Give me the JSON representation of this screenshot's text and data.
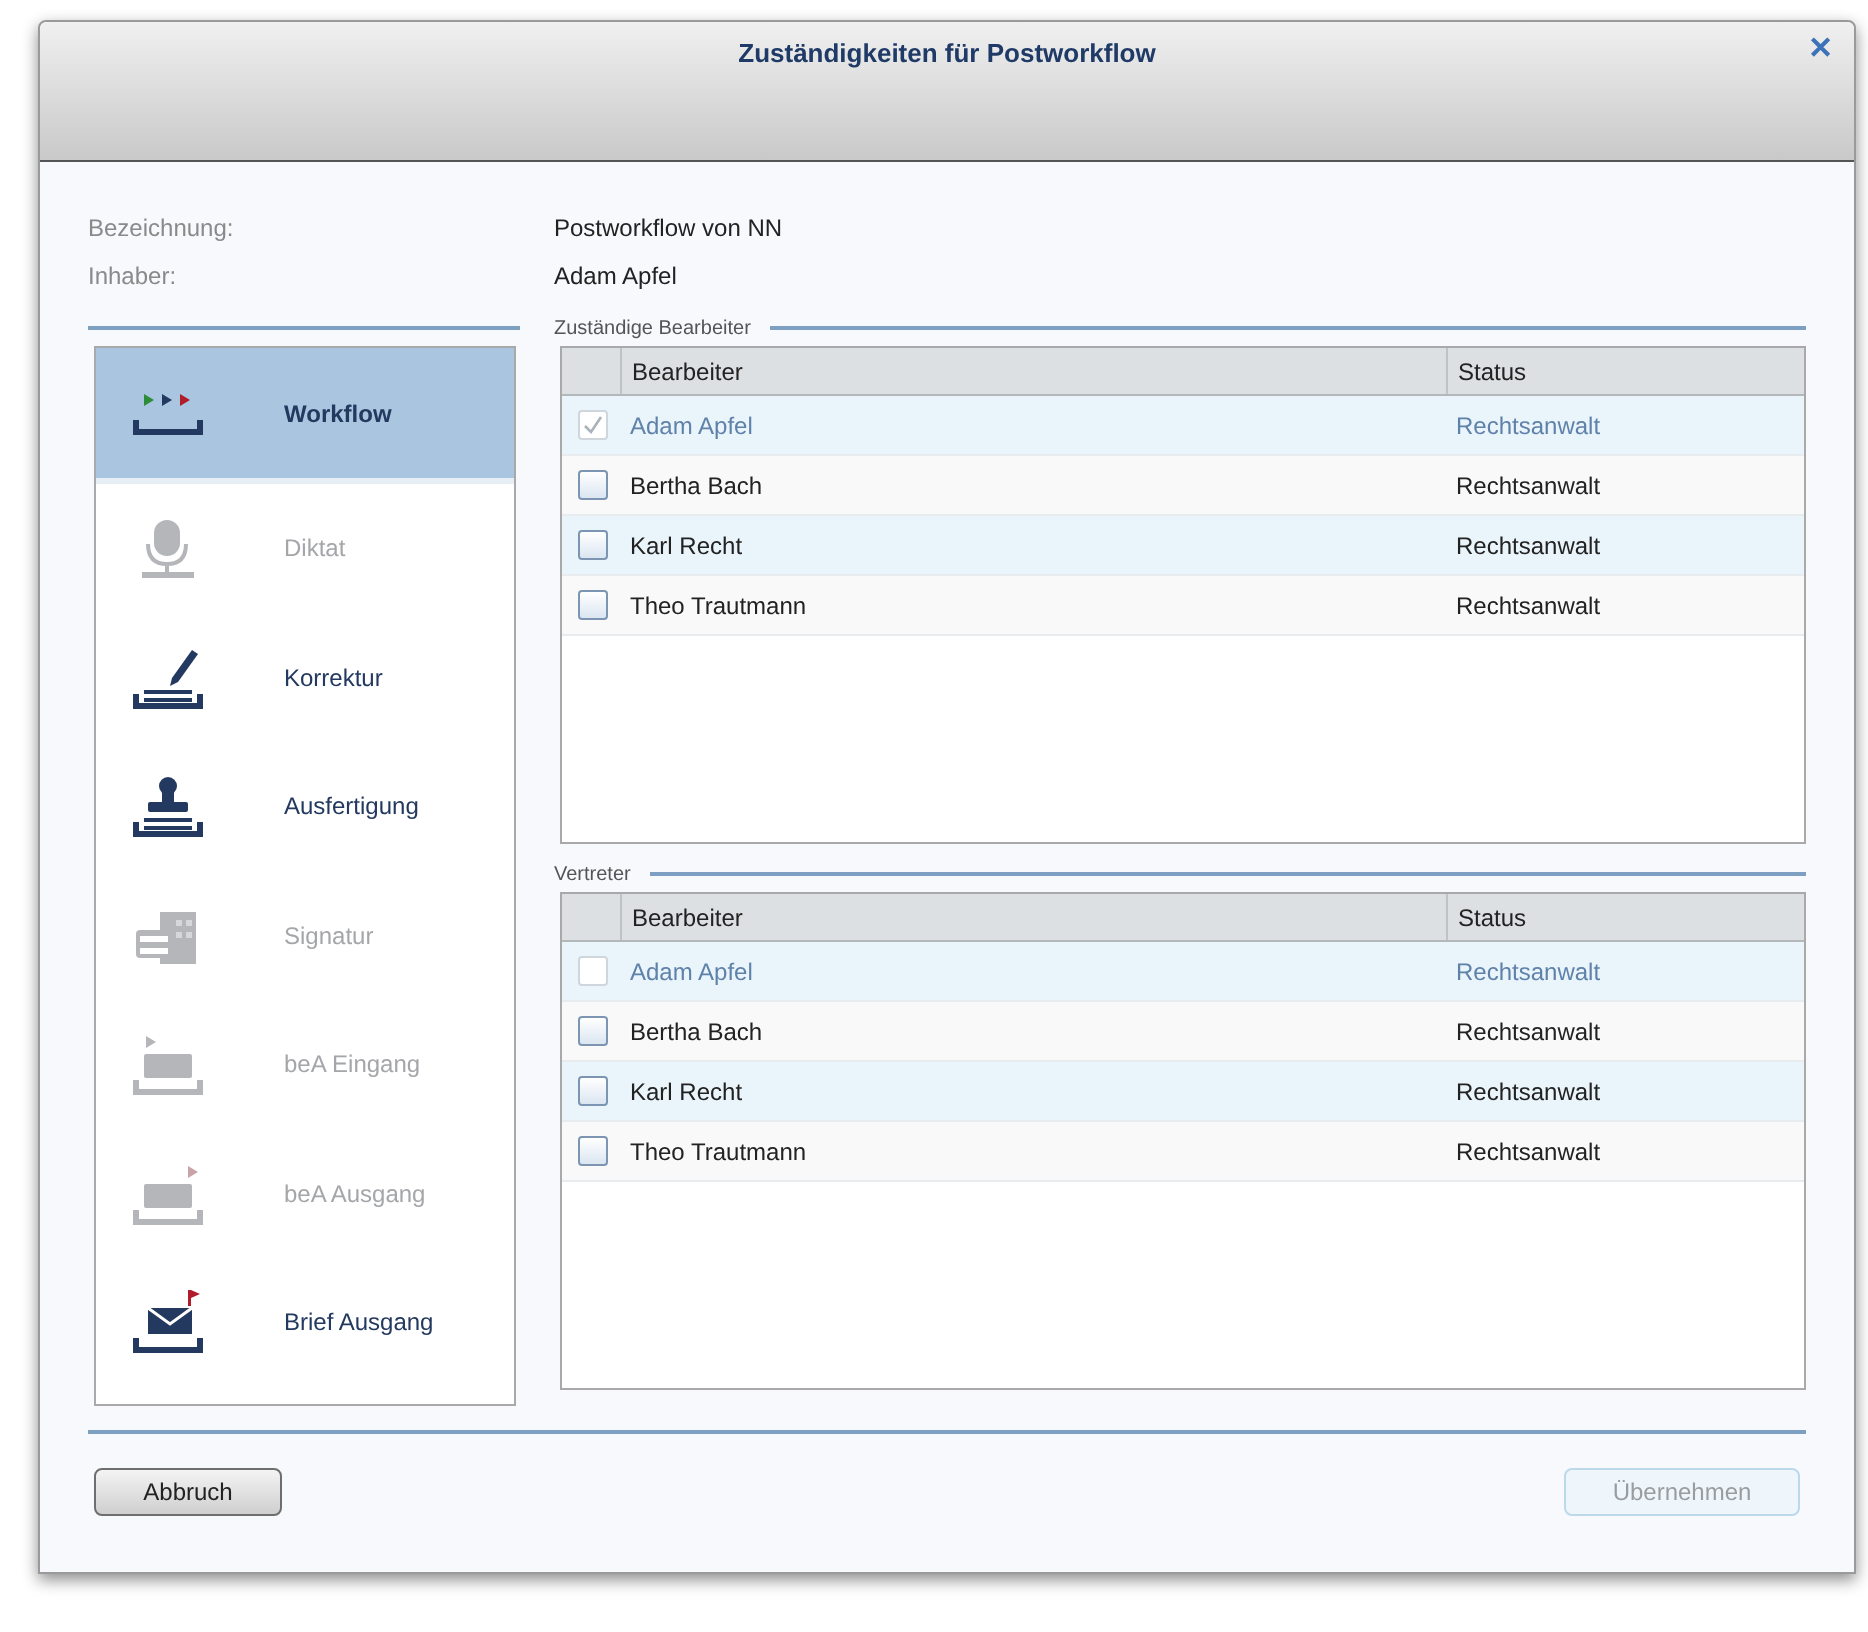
{
  "window": {
    "title": "Zuständigkeiten für Postworkflow",
    "close": "✕"
  },
  "info": [
    {
      "label": "Bezeichnung:",
      "value": "Postworkflow von NN"
    },
    {
      "label": "Inhaber:",
      "value": "Adam Apfel"
    }
  ],
  "sidebar": {
    "items": [
      {
        "kind": "workflow",
        "label": "Workflow",
        "selected": true,
        "disabled": false
      },
      {
        "kind": "microphone",
        "label": "Diktat",
        "selected": false,
        "disabled": true
      },
      {
        "kind": "pen",
        "label": "Korrektur",
        "selected": false,
        "disabled": false
      },
      {
        "kind": "stamp",
        "label": "Ausfertigung",
        "selected": false,
        "disabled": false
      },
      {
        "kind": "card",
        "label": "Signatur",
        "selected": false,
        "disabled": true
      },
      {
        "kind": "inbox",
        "label": "beA Eingang",
        "selected": false,
        "disabled": true
      },
      {
        "kind": "outbox",
        "label": "beA Ausgang",
        "selected": false,
        "disabled": true
      },
      {
        "kind": "letter",
        "label": "Brief Ausgang",
        "selected": false,
        "disabled": false
      }
    ]
  },
  "sections": [
    {
      "title": "Zuständige Bearbeiter",
      "columns": [
        "Bearbeiter",
        "Status"
      ],
      "rows": [
        {
          "name": "Adam Apfel",
          "status": "Rechtsanwalt",
          "checked": true,
          "disabled": true
        },
        {
          "name": "Bertha Bach",
          "status": "Rechtsanwalt",
          "checked": false,
          "disabled": false
        },
        {
          "name": "Karl Recht",
          "status": "Rechtsanwalt",
          "checked": false,
          "disabled": false
        },
        {
          "name": "Theo Trautmann",
          "status": "Rechtsanwalt",
          "checked": false,
          "disabled": false
        }
      ]
    },
    {
      "title": "Vertreter",
      "columns": [
        "Bearbeiter",
        "Status"
      ],
      "rows": [
        {
          "name": "Adam Apfel",
          "status": "Rechtsanwalt",
          "checked": false,
          "disabled": true
        },
        {
          "name": "Bertha Bach",
          "status": "Rechtsanwalt",
          "checked": false,
          "disabled": false
        },
        {
          "name": "Karl Recht",
          "status": "Rechtsanwalt",
          "checked": false,
          "disabled": false
        },
        {
          "name": "Theo Trautmann",
          "status": "Rechtsanwalt",
          "checked": false,
          "disabled": false
        }
      ]
    }
  ],
  "buttons": [
    {
      "label": "Abbruch",
      "disabled": false
    },
    {
      "label": "Übernehmen",
      "disabled": true
    }
  ]
}
